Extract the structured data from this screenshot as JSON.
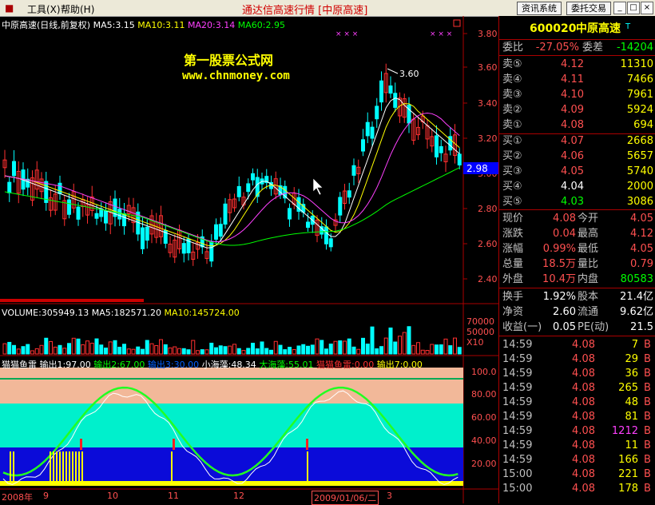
{
  "menu": {
    "tools": "工具(X)",
    "help": "帮助(H)"
  },
  "app_title": "通达信高速行情 [中原高速]",
  "buttons": {
    "trade_system": "资讯系统",
    "delegate": "委托交易"
  },
  "window_buttons": [
    "_",
    "□",
    "×"
  ],
  "chart": {
    "header": "中原高速(日线,前复权)",
    "ma_labels": [
      {
        "text": "MA5:3.15",
        "color": "#ffffff"
      },
      {
        "text": "MA10:3.11",
        "color": "#ffff00"
      },
      {
        "text": "MA20:3.14",
        "color": "#ff40ff"
      },
      {
        "text": "MA60:2.95",
        "color": "#00ff00"
      }
    ],
    "watermark_title": "第一股票公式网",
    "watermark_url": "www.chnmoney.com",
    "peak_label": "3.60",
    "current_price_tag": "2.98",
    "price_axis": [
      "3.80",
      "3.60",
      "3.40",
      "3.20",
      "3.00",
      "2.80",
      "2.60",
      "2.40"
    ],
    "volume_header": {
      "volume": "VOLUME:305949.13",
      "ma5": "MA5:182571.20",
      "ma10": "MA10:145724.00"
    },
    "volume_axis": [
      "70000",
      "50000",
      "X10"
    ],
    "indicator_header": [
      {
        "text": "猫猫鱼雷",
        "color": "#ffffff"
      },
      {
        "text": "输出1:97.00",
        "color": "#ffffff"
      },
      {
        "text": "输出2:67.00",
        "color": "#00ff00"
      },
      {
        "text": "输出3:30.00",
        "color": "#0060ff"
      },
      {
        "text": "小海藻:48.34",
        "color": "#ffffff"
      },
      {
        "text": "大海藻:55.01",
        "color": "#00ff00"
      },
      {
        "text": "猫猫鱼雷:0.00",
        "color": "#ff3030"
      },
      {
        "text": "输出7:0.00",
        "color": "#ffff00"
      }
    ],
    "indicator_axis": [
      "100.0",
      "80.00",
      "60.00",
      "40.00",
      "20.00"
    ],
    "date_axis": [
      "2008年",
      "9",
      "10",
      "11",
      "12",
      "2009/01/06/二",
      "3"
    ]
  },
  "quote": {
    "code": "600020",
    "name": "中原高速",
    "weibi_label": "委比",
    "weibi_value": "-27.05%",
    "weicha_label": "委差",
    "weicha_value": "-14204",
    "sells": [
      {
        "label": "卖⑤",
        "price": "4.12",
        "qty": "11310"
      },
      {
        "label": "卖④",
        "price": "4.11",
        "qty": "7466"
      },
      {
        "label": "卖③",
        "price": "4.10",
        "qty": "7961"
      },
      {
        "label": "卖②",
        "price": "4.09",
        "qty": "5924"
      },
      {
        "label": "卖①",
        "price": "4.08",
        "qty": "694"
      }
    ],
    "buys": [
      {
        "label": "买①",
        "price": "4.07",
        "qty": "2668"
      },
      {
        "label": "买②",
        "price": "4.06",
        "qty": "5657"
      },
      {
        "label": "买③",
        "price": "4.05",
        "qty": "5740"
      },
      {
        "label": "买④",
        "price": "4.04",
        "qty": "2000"
      },
      {
        "label": "买⑤",
        "price": "4.03",
        "qty": "3086"
      }
    ],
    "stats": [
      {
        "l1": "现价",
        "v1": "4.08",
        "l2": "今开",
        "v2": "4.05"
      },
      {
        "l1": "涨跌",
        "v1": "0.04",
        "l2": "最高",
        "v2": "4.12"
      },
      {
        "l1": "涨幅",
        "v1": "0.99%",
        "l2": "最低",
        "v2": "4.05"
      },
      {
        "l1": "总量",
        "v1": "18.5万",
        "l2": "量比",
        "v2": "0.79"
      },
      {
        "l1": "外盘",
        "v1": "10.4万",
        "l2": "内盘",
        "v2": "80583"
      }
    ],
    "finance": [
      {
        "l1": "换手",
        "v1": "1.92%",
        "l2": "股本",
        "v2": "21.4亿"
      },
      {
        "l1": "净资",
        "v1": "2.60",
        "l2": "流通",
        "v2": "9.62亿"
      },
      {
        "l1": "收益(一)",
        "v1": "0.05",
        "l2": "PE(动)",
        "v2": "21.5"
      }
    ],
    "ticks": [
      {
        "time": "14:59",
        "price": "4.08",
        "vol": "7",
        "dir": "B"
      },
      {
        "time": "14:59",
        "price": "4.08",
        "vol": "29",
        "dir": "B"
      },
      {
        "time": "14:59",
        "price": "4.08",
        "vol": "36",
        "dir": "B"
      },
      {
        "time": "14:59",
        "price": "4.08",
        "vol": "265",
        "dir": "B"
      },
      {
        "time": "14:59",
        "price": "4.08",
        "vol": "48",
        "dir": "B"
      },
      {
        "time": "14:59",
        "price": "4.08",
        "vol": "81",
        "dir": "B"
      },
      {
        "time": "14:59",
        "price": "4.08",
        "vol": "1212",
        "dir": "B"
      },
      {
        "time": "14:59",
        "price": "4.08",
        "vol": "11",
        "dir": "B"
      },
      {
        "time": "14:59",
        "price": "4.08",
        "vol": "166",
        "dir": "B"
      },
      {
        "time": "15:00",
        "price": "4.08",
        "vol": "221",
        "dir": "B"
      },
      {
        "time": "15:00",
        "price": "4.08",
        "vol": "178",
        "dir": "B"
      }
    ]
  }
}
